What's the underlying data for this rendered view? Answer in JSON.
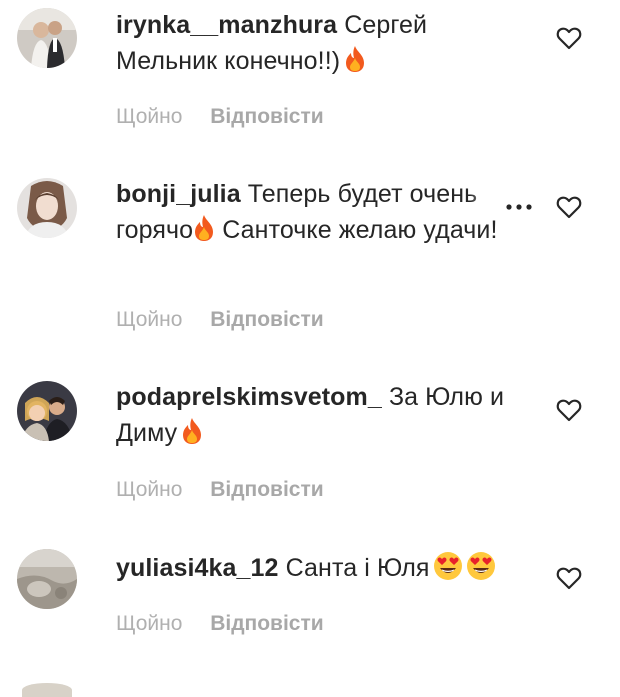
{
  "comments": [
    {
      "username": "irynka__manzhura",
      "text": "Сергей Мельник конечно!!)",
      "emoji": "fire-emoji",
      "time": "Щойно",
      "reply": "Відповісти"
    },
    {
      "username": "bonji_julia",
      "text": "Теперь будет очень горячо",
      "text_after_emoji": "Санточке желаю удачи!",
      "emoji": "fire-emoji",
      "time": "Щойно",
      "reply": "Відповісти"
    },
    {
      "username": "podaprelskimsvetom_",
      "text": "За Юлю и Диму",
      "emoji": "fire-emoji",
      "time": "Щойно",
      "reply": "Відповісти"
    },
    {
      "username": "yuliasi4ka_12",
      "text": "Санта і Юля",
      "emoji": "heart-eyes-emoji",
      "time": "Щойно",
      "reply": "Відповісти"
    }
  ],
  "icons": {
    "like": "heart-outline-icon",
    "more": "more-options-icon"
  },
  "colors": {
    "text": "#262626",
    "meta": "#b0b0b0",
    "fire": "#f25a1e",
    "emoji_face": "#ffc83d",
    "heart": "#e8212b"
  }
}
